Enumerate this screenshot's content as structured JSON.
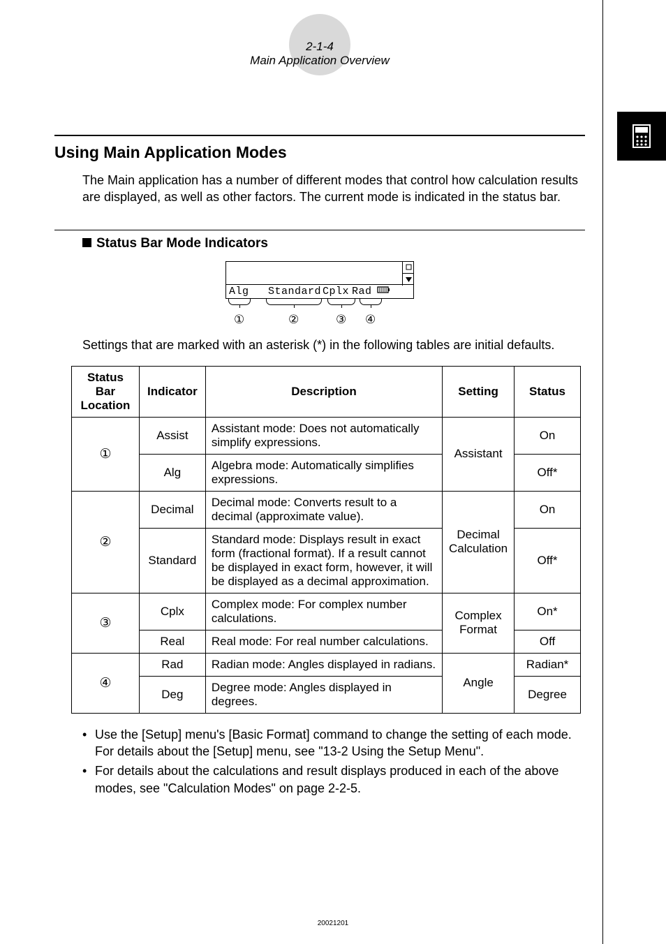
{
  "header": {
    "page_ref": "2-1-4",
    "title": "Main Application Overview"
  },
  "section_title": "Using Main Application Modes",
  "intro_paragraph": "The Main application has a number of different modes that control how calculation results are displayed, as well as other factors. The current mode is indicated in the status bar.",
  "subsection_title": "Status Bar Mode Indicators",
  "status_bar": {
    "seg1": "Alg",
    "seg2": "Standard",
    "seg3": "Cplx",
    "seg4": "Rad",
    "battery_glyph": "▥",
    "circled": {
      "one": "①",
      "two": "②",
      "three": "③",
      "four": "④"
    }
  },
  "defaults_caption": "Settings that are marked with an asterisk (*) in the following tables are initial defaults.",
  "table": {
    "headers": {
      "loc": "Status Bar Location",
      "indicator": "Indicator",
      "description": "Description",
      "setting": "Setting",
      "status": "Status"
    },
    "rows": [
      {
        "loc": "①",
        "indicator": "Assist",
        "description": "Assistant mode: Does not automatically simplify expressions.",
        "setting": "Assistant",
        "status": "On",
        "loc_rowspan": 2,
        "setting_rowspan": 2
      },
      {
        "indicator": "Alg",
        "description": "Algebra mode: Automatically simplifies expressions.",
        "status": "Off*"
      },
      {
        "loc": "②",
        "indicator": "Decimal",
        "description": "Decimal mode: Converts result to a decimal (approximate value).",
        "setting": "Decimal Calculation",
        "status": "On",
        "loc_rowspan": 2,
        "setting_rowspan": 2
      },
      {
        "indicator": "Standard",
        "description": "Standard mode: Displays result in exact form (fractional format). If a result cannot be displayed in exact form, however, it will be displayed as a decimal approximation.",
        "status": "Off*"
      },
      {
        "loc": "③",
        "indicator": "Cplx",
        "description": "Complex mode: For complex number calculations.",
        "setting": "Complex Format",
        "status": "On*",
        "loc_rowspan": 2,
        "setting_rowspan": 2
      },
      {
        "indicator": "Real",
        "description": "Real mode: For real number calculations.",
        "status": "Off"
      },
      {
        "loc": "④",
        "indicator": "Rad",
        "description": "Radian mode: Angles displayed in radians.",
        "setting": "Angle",
        "status": "Radian*",
        "loc_rowspan": 2,
        "setting_rowspan": 2
      },
      {
        "indicator": "Deg",
        "description": "Degree mode: Angles displayed in degrees.",
        "status": "Degree"
      }
    ]
  },
  "notes": [
    "Use the [Setup] menu's [Basic Format] command to change the setting of each mode. For details about the [Setup] menu, see \"13-2 Using the Setup Menu\".",
    "For details about the calculations and result displays produced in each of the above modes, see \"Calculation Modes\" on page 2-2-5."
  ],
  "footer_code": "20021201"
}
